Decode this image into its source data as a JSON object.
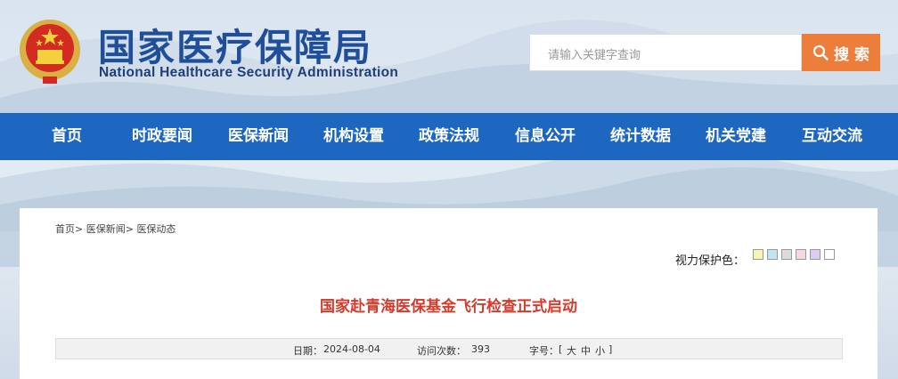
{
  "header": {
    "title_cn": "国家医疗保障局",
    "title_en": "National Healthcare Security Administration"
  },
  "search": {
    "placeholder": "请输入关键字查询",
    "button_label": "搜 索",
    "button_color": "#ec7d3a"
  },
  "nav": {
    "color": "#1e67c0",
    "items": [
      {
        "label": "首页"
      },
      {
        "label": "时政要闻"
      },
      {
        "label": "医保新闻"
      },
      {
        "label": "机构设置"
      },
      {
        "label": "政策法规"
      },
      {
        "label": "信息公开"
      },
      {
        "label": "统计数据"
      },
      {
        "label": "机关党建"
      },
      {
        "label": "互动交流"
      }
    ]
  },
  "breadcrumb": {
    "items": [
      "首页",
      "医保新闻",
      "医保动态"
    ],
    "separator": ">"
  },
  "eye_protection": {
    "label": "视力保护色：",
    "swatches": [
      "#f7f3b2",
      "#bfe4f3",
      "#dcdcdc",
      "#f6d9e0",
      "#dccbf2",
      "#ffffff"
    ]
  },
  "article": {
    "title": "国家赴青海医保基金飞行检查正式启动",
    "title_color": "#d33b2c",
    "date_label": "日期：",
    "date": "2024-08-04",
    "visits_label": "访问次数：",
    "visits": "393",
    "font_label": "字号：",
    "font_open": "[",
    "font_large": "大",
    "font_medium": "中",
    "font_small": "小",
    "font_close": "]"
  }
}
